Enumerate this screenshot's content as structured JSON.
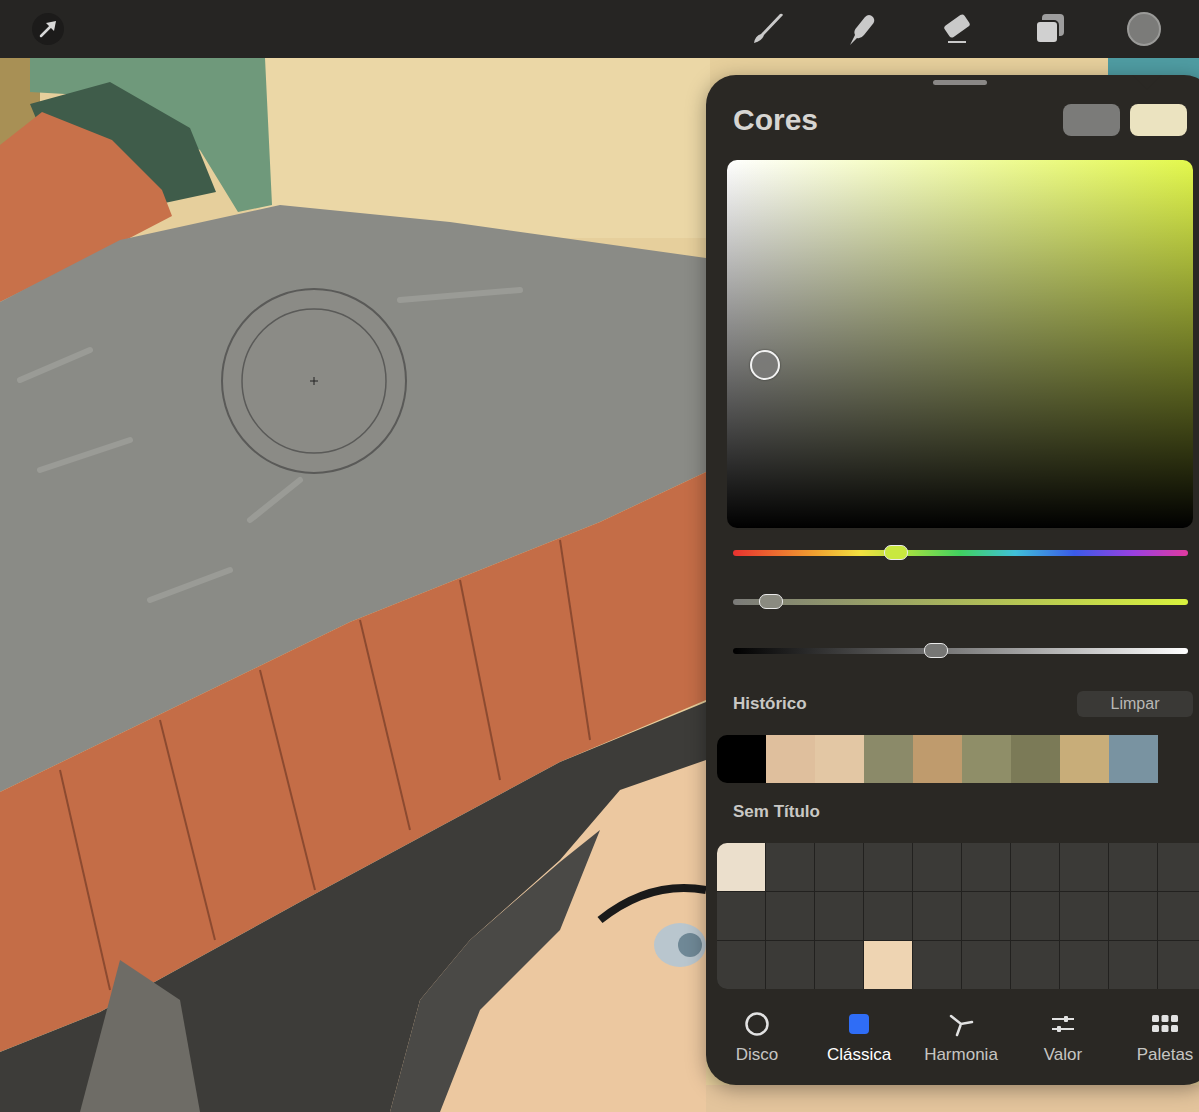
{
  "color_panel": {
    "title": "Cores",
    "current_color": "#7b7b79",
    "previous_color": "#ebe3c0",
    "sliders": [
      {
        "kind": "hue",
        "level": 0.356
      },
      {
        "kind": "saturation",
        "level": 0.081
      },
      {
        "kind": "brightness",
        "level": 0.444
      }
    ],
    "history": {
      "title": "Histórico",
      "clear_button": "Limpar",
      "swatches": [
        {
          "color": "#000000"
        },
        {
          "color": "#dfbf9d"
        },
        {
          "color": "#e3c7a4"
        },
        {
          "color": "#8b8a69"
        },
        {
          "color": "#bf9b6d"
        },
        {
          "color": "#8f8e68"
        },
        {
          "color": "#7b7a57"
        },
        {
          "color": "#c8ad79"
        },
        {
          "color": "#7993a1"
        }
      ]
    },
    "palette": {
      "title": "Sem Título",
      "swatches": [
        {
          "filled": true,
          "color": "#ebdfcc"
        },
        {
          "filled": false,
          "color": ""
        },
        {
          "filled": false,
          "color": ""
        },
        {
          "filled": false,
          "color": ""
        },
        {
          "filled": false,
          "color": ""
        },
        {
          "filled": false,
          "color": ""
        },
        {
          "filled": false,
          "color": ""
        },
        {
          "filled": false,
          "color": ""
        },
        {
          "filled": false,
          "color": ""
        },
        {
          "filled": false,
          "color": ""
        },
        {
          "filled": false,
          "color": ""
        },
        {
          "filled": false,
          "color": ""
        },
        {
          "filled": false,
          "color": ""
        },
        {
          "filled": false,
          "color": ""
        },
        {
          "filled": false,
          "color": ""
        },
        {
          "filled": false,
          "color": ""
        },
        {
          "filled": false,
          "color": ""
        },
        {
          "filled": false,
          "color": ""
        },
        {
          "filled": false,
          "color": ""
        },
        {
          "filled": false,
          "color": ""
        },
        {
          "filled": false,
          "color": ""
        },
        {
          "filled": false,
          "color": ""
        },
        {
          "filled": false,
          "color": ""
        },
        {
          "filled": true,
          "color": "#eed4b2"
        },
        {
          "filled": false,
          "color": ""
        },
        {
          "filled": false,
          "color": ""
        },
        {
          "filled": false,
          "color": ""
        },
        {
          "filled": false,
          "color": ""
        },
        {
          "filled": false,
          "color": ""
        },
        {
          "filled": false,
          "color": ""
        }
      ]
    },
    "tabs": [
      {
        "label": "Disco",
        "kind": "disc",
        "selected": false
      },
      {
        "label": "Clássica",
        "kind": "classic",
        "selected": true
      },
      {
        "label": "Harmonia",
        "kind": "harmony",
        "selected": false
      },
      {
        "label": "Valor",
        "kind": "value",
        "selected": false
      },
      {
        "label": "Paletas",
        "kind": "palettes",
        "selected": false
      }
    ]
  }
}
